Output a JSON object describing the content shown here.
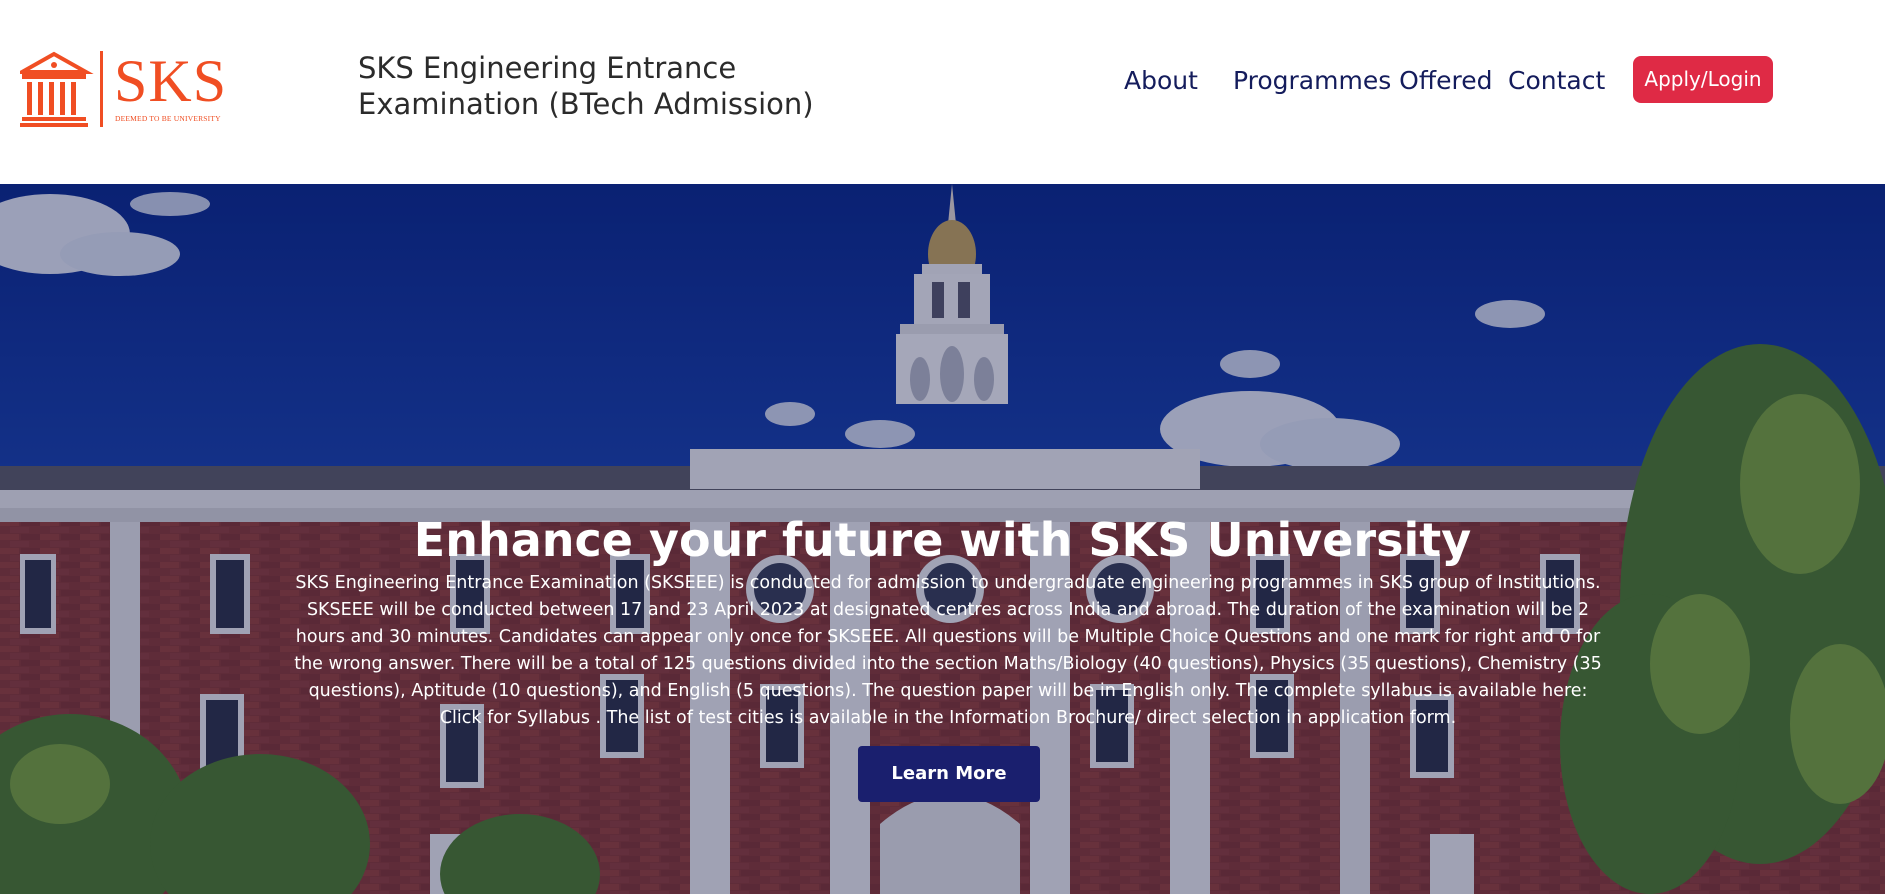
{
  "logo": {
    "text": "SKS",
    "tagline": "DEEMED TO BE UNIVERSITY",
    "icon": "university-building-icon",
    "color": "#f04e23"
  },
  "header": {
    "title": "SKS Engineering Entrance Examination (BTech Admission)"
  },
  "nav": {
    "about": "About",
    "programmes": "Programmes Offered",
    "contact": "Contact",
    "apply_login": "Apply/Login"
  },
  "hero": {
    "heading": "Enhance your future with SKS University",
    "description": "SKS Engineering Entrance Examination (SKSEEE) is conducted for admission to undergraduate engineering programmes in SKS group of Institutions. SKSEEE will be conducted between 17 and 23 April 2023 at designated centres across India and abroad. The duration of the examination will be 2 hours and 30 minutes. Candidates can appear only once for SKSEEE. All questions will be Multiple Choice Questions and one mark for right and 0 for the wrong answer. There will be a total of 125 questions divided into the section Maths/Biology (40 questions), Physics (35 questions), Chemistry (35 questions), Aptitude (10 questions), and English (5 questions). The question paper will be in English only. The complete syllabus is available here: Click for Syllabus . The list of test cities is available in the Information Brochure/ direct selection in application form.",
    "cta": "Learn More"
  },
  "colors": {
    "brand": "#f04e23",
    "nav_text": "#141c5c",
    "apply_button": "#df2a45",
    "cta_button": "#1a1f6e"
  }
}
